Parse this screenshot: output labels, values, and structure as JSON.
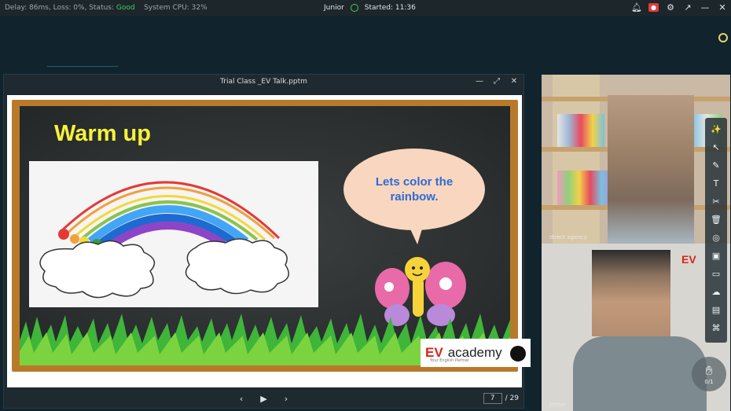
{
  "topbar": {
    "status_prefix": "Delay: 86ms, Loss: 0%, Status:",
    "status_good": "Good",
    "cpu": "System CPU: 32%",
    "user": "Junior",
    "started": "Started: 11:36",
    "icons": [
      "bell-icon",
      "record-icon",
      "settings-icon",
      "pin-icon",
      "minimize-icon",
      "close-icon"
    ]
  },
  "ppt": {
    "title": "Trial Class _EV Talk.pptm",
    "page_current": "7",
    "page_total": "/ 29",
    "slide": {
      "heading": "Warm up",
      "bubble": "Lets color the rainbow.",
      "logo_ev": "EV",
      "logo_academy": "academy",
      "logo_sub": "Your English Partner"
    }
  },
  "cams": {
    "top_label": "direct agency",
    "bottom_label": "Jethel",
    "bottom_sign": "EV"
  },
  "hand": {
    "count": "0/1"
  },
  "colors": {
    "good": "#3ecf5a",
    "heading": "#f5f23c",
    "bubble_text": "#2e6bd6",
    "frame": "#b87a2a"
  }
}
